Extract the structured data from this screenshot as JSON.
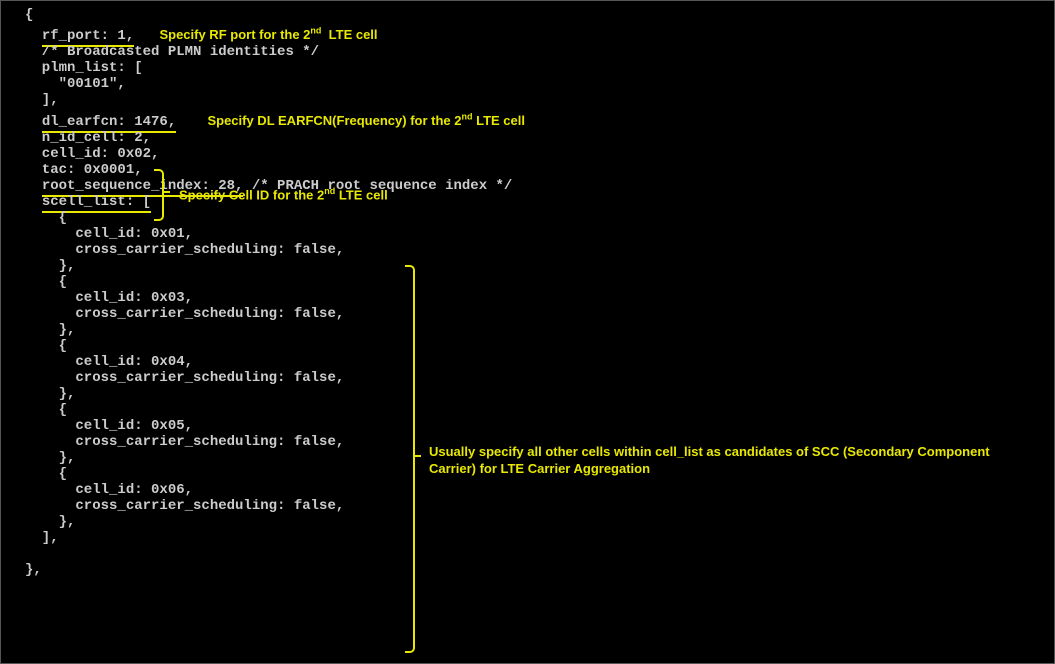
{
  "code": {
    "l0": "{",
    "l1a": "rf_port: 1,",
    "l2": "  /* Broadcasted PLMN identities */",
    "l3": "  plmn_list: [",
    "l4": "    \"00101\",",
    "l5": "  ],",
    "l6a": "dl_earfcn: 1476,",
    "l7": "  n_id_cell: 2,",
    "l8": "  cell_id: 0x02,",
    "l9": "  tac: 0x0001,",
    "l10a": "root_sequence_index: 28,",
    "l10b": " /* PRACH root sequence index */",
    "l11a": "scell_list: [",
    "l12": "    {",
    "l13": "      cell_id: 0x01,",
    "l14": "      cross_carrier_scheduling: false,",
    "l15": "    },",
    "l16": "    {",
    "l17": "      cell_id: 0x03,",
    "l18": "      cross_carrier_scheduling: false,",
    "l19": "    },",
    "l20": "    {",
    "l21": "      cell_id: 0x04,",
    "l22": "      cross_carrier_scheduling: false,",
    "l23": "    },",
    "l24": "    {",
    "l25": "      cell_id: 0x05,",
    "l26": "      cross_carrier_scheduling: false,",
    "l27": "    },",
    "l28": "    {",
    "l29": "      cell_id: 0x06,",
    "l30": "      cross_carrier_scheduling: false,",
    "l31": "    },",
    "l32": "  ],",
    "l33": " ",
    "l34": "},"
  },
  "annot": {
    "rf_port_a": "Specify RF port for the 2",
    "rf_port_b": "  LTE cell",
    "nd": "nd",
    "earfcn_a": "Specify DL EARFCN(Frequency) for the 2",
    "earfcn_b": " LTE cell",
    "cellid_a": "Specify Cell ID for the 2",
    "cellid_b": "  LTE cell",
    "scell": "Usually specify all other cells within cell_list as candidates of SCC (Secondary Component Carrier) for LTE Carrier Aggregation"
  }
}
